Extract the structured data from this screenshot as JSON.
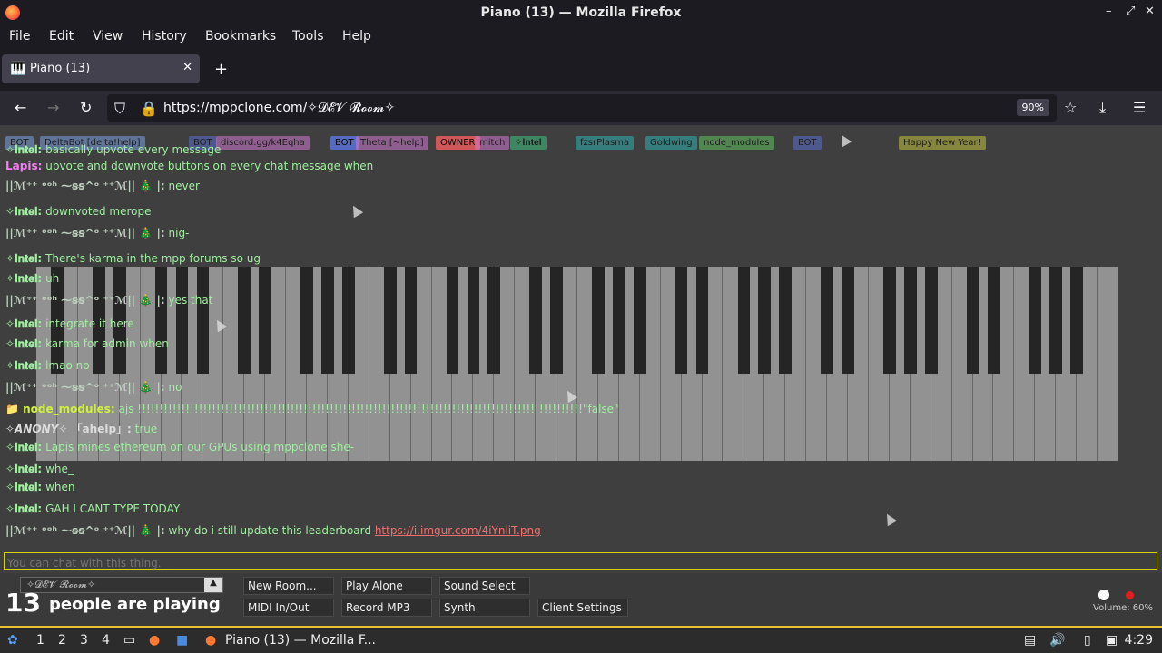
{
  "window": {
    "title": "Piano (13) — Mozilla Firefox"
  },
  "menu": [
    "File",
    "Edit",
    "View",
    "History",
    "Bookmarks",
    "Tools",
    "Help"
  ],
  "tab": {
    "label": "Piano (13)"
  },
  "url": {
    "text": "https://mppclone.com/✧𝓓𝓔𝓥 𝓡𝓸𝓸𝓶✧",
    "zoom": "90%"
  },
  "badges": [
    {
      "text": "BOT",
      "color": "#7aa0e0"
    },
    {
      "text": "DeltaBot [delta!help]",
      "color": "#7aa0e0"
    },
    {
      "text": "BOT",
      "color": "#5a6fd0"
    },
    {
      "text": "discord.gg/k4Eqha",
      "color": "#d07ad0"
    },
    {
      "text": "BOT",
      "color": "#5a6fd0"
    },
    {
      "text": "Theta [~help]",
      "color": "#d07ad0"
    },
    {
      "text": "OWNER",
      "color": "#e05a5a"
    },
    {
      "text": "mitch",
      "color": "#d07ad0"
    },
    {
      "text": "✧𝐈𝐧𝐭𝐞𝐥",
      "color": "#40c080"
    },
    {
      "text": "fzsrPlasma",
      "color": "#30b0b0"
    },
    {
      "text": "Goldwing",
      "color": "#30b0b0"
    },
    {
      "text": "node_modules",
      "color": "#60c060"
    },
    {
      "text": "BOT",
      "color": "#5a6fd0"
    },
    {
      "text": "Happy New Year!",
      "color": "#c0c040"
    }
  ],
  "chat": [
    {
      "nick": "✧𝐈𝐧𝐭𝐞𝐥:",
      "text": "basically upvote every message",
      "nickColor": "#9ef09e"
    },
    {
      "nick": "Lapis:",
      "text": "upvote and downvote buttons on every chat message when",
      "nickColor": "#f080f0"
    },
    {
      "nick": "||ℳ⁺⁺ ᵒᵒʰ ⁓ꞩꞩ^ᵒ ⁺⁺ℳ|| 🎄 |:",
      "text": "never",
      "nickColor": "#c0d0c0"
    },
    {
      "nick": "✧𝐈𝐧𝐭𝐞𝐥:",
      "text": "downvoted merope",
      "nickColor": "#9ef09e"
    },
    {
      "nick": "||ℳ⁺⁺ ᵒᵒʰ ⁓ꞩꞩ^ᵒ ⁺⁺ℳ|| 🎄 |:",
      "text": "nig-",
      "nickColor": "#c0d0c0"
    },
    {
      "nick": "✧𝐈𝐧𝐭𝐞𝐥:",
      "text": "There's karma in the mpp forums so ug",
      "nickColor": "#9ef09e"
    },
    {
      "nick": "✧𝐈𝐧𝐭𝐞𝐥:",
      "text": "uh",
      "nickColor": "#9ef09e"
    },
    {
      "nick": "||ℳ⁺⁺ ᵒᵒʰ ⁓ꞩꞩ^ᵒ ⁺⁺ℳ|| 🎄 |:",
      "text": "yes that",
      "nickColor": "#c0d0c0"
    },
    {
      "nick": "✧𝐈𝐧𝐭𝐞𝐥:",
      "text": "integrate it here",
      "nickColor": "#9ef09e"
    },
    {
      "nick": "✧𝐈𝐧𝐭𝐞𝐥:",
      "text": "karma for admin when",
      "nickColor": "#9ef09e"
    },
    {
      "nick": "✧𝐈𝐧𝐭𝐞𝐥:",
      "text": "lmao no",
      "nickColor": "#9ef09e"
    },
    {
      "nick": "||ℳ⁺⁺ ᵒᵒʰ ⁓ꞩꞩ^ᵒ ⁺⁺ℳ|| 🎄 |:",
      "text": "no",
      "nickColor": "#c0d0c0"
    },
    {
      "nick": "📁 node_modules:",
      "text": "ajs !!!!!!!!!!!!!!!!!!!!!!!!!!!!!!!!!!!!!!!!!!!!!!!!!!!!!!!!!!!!!!!!!!!!!!!!!!!!!!!!!!!!!!!!!!!!!!!!!!!!!!\"false\"",
      "nickColor": "#d0f040"
    },
    {
      "nick": "✧𝘼𝙉𝙊𝙉𝙔✧ 「ahelp」:",
      "text": "true",
      "nickColor": "#dddddd"
    },
    {
      "nick": "✧𝐈𝐧𝐭𝐞𝐥:",
      "text": "Lapis mines ethereum on our GPUs using mppclone she-",
      "nickColor": "#9ef09e"
    },
    {
      "nick": "✧𝐈𝐧𝐭𝐞𝐥:",
      "text": "whe_",
      "nickColor": "#9ef09e"
    },
    {
      "nick": "✧𝐈𝐧𝐭𝐞𝐥:",
      "text": "when",
      "nickColor": "#9ef09e"
    },
    {
      "nick": "✧𝐈𝐧𝐭𝐞𝐥:",
      "text": "GAH I CANT TYPE TODAY",
      "nickColor": "#9ef09e"
    },
    {
      "nick": "||ℳ⁺⁺ ᵒᵒʰ ⁓ꞩꞩ^ᵒ ⁺⁺ℳ|| 🎄 |:",
      "text": "why do i still update this leaderboard",
      "nickColor": "#c0d0c0",
      "link": "https://i.imgur.com/4iYnliT.png"
    }
  ],
  "chatInput": {
    "placeholder": "You can chat with this thing."
  },
  "bottom": {
    "room": "✧𝓓𝓔𝓥 𝓡𝓸𝓸𝓶✧",
    "count": "13",
    "countLabel": "people are playing",
    "buttons": [
      "New Room...",
      "Play Alone",
      "Sound Select",
      "MIDI In/Out",
      "Record MP3",
      "Synth",
      "Client Settings"
    ],
    "volume": "Volume: 60%"
  },
  "taskbar": {
    "workspaces": [
      "1",
      "2",
      "3",
      "4"
    ],
    "window": "Piano (13) — Mozilla F...",
    "clock": "4:29"
  }
}
